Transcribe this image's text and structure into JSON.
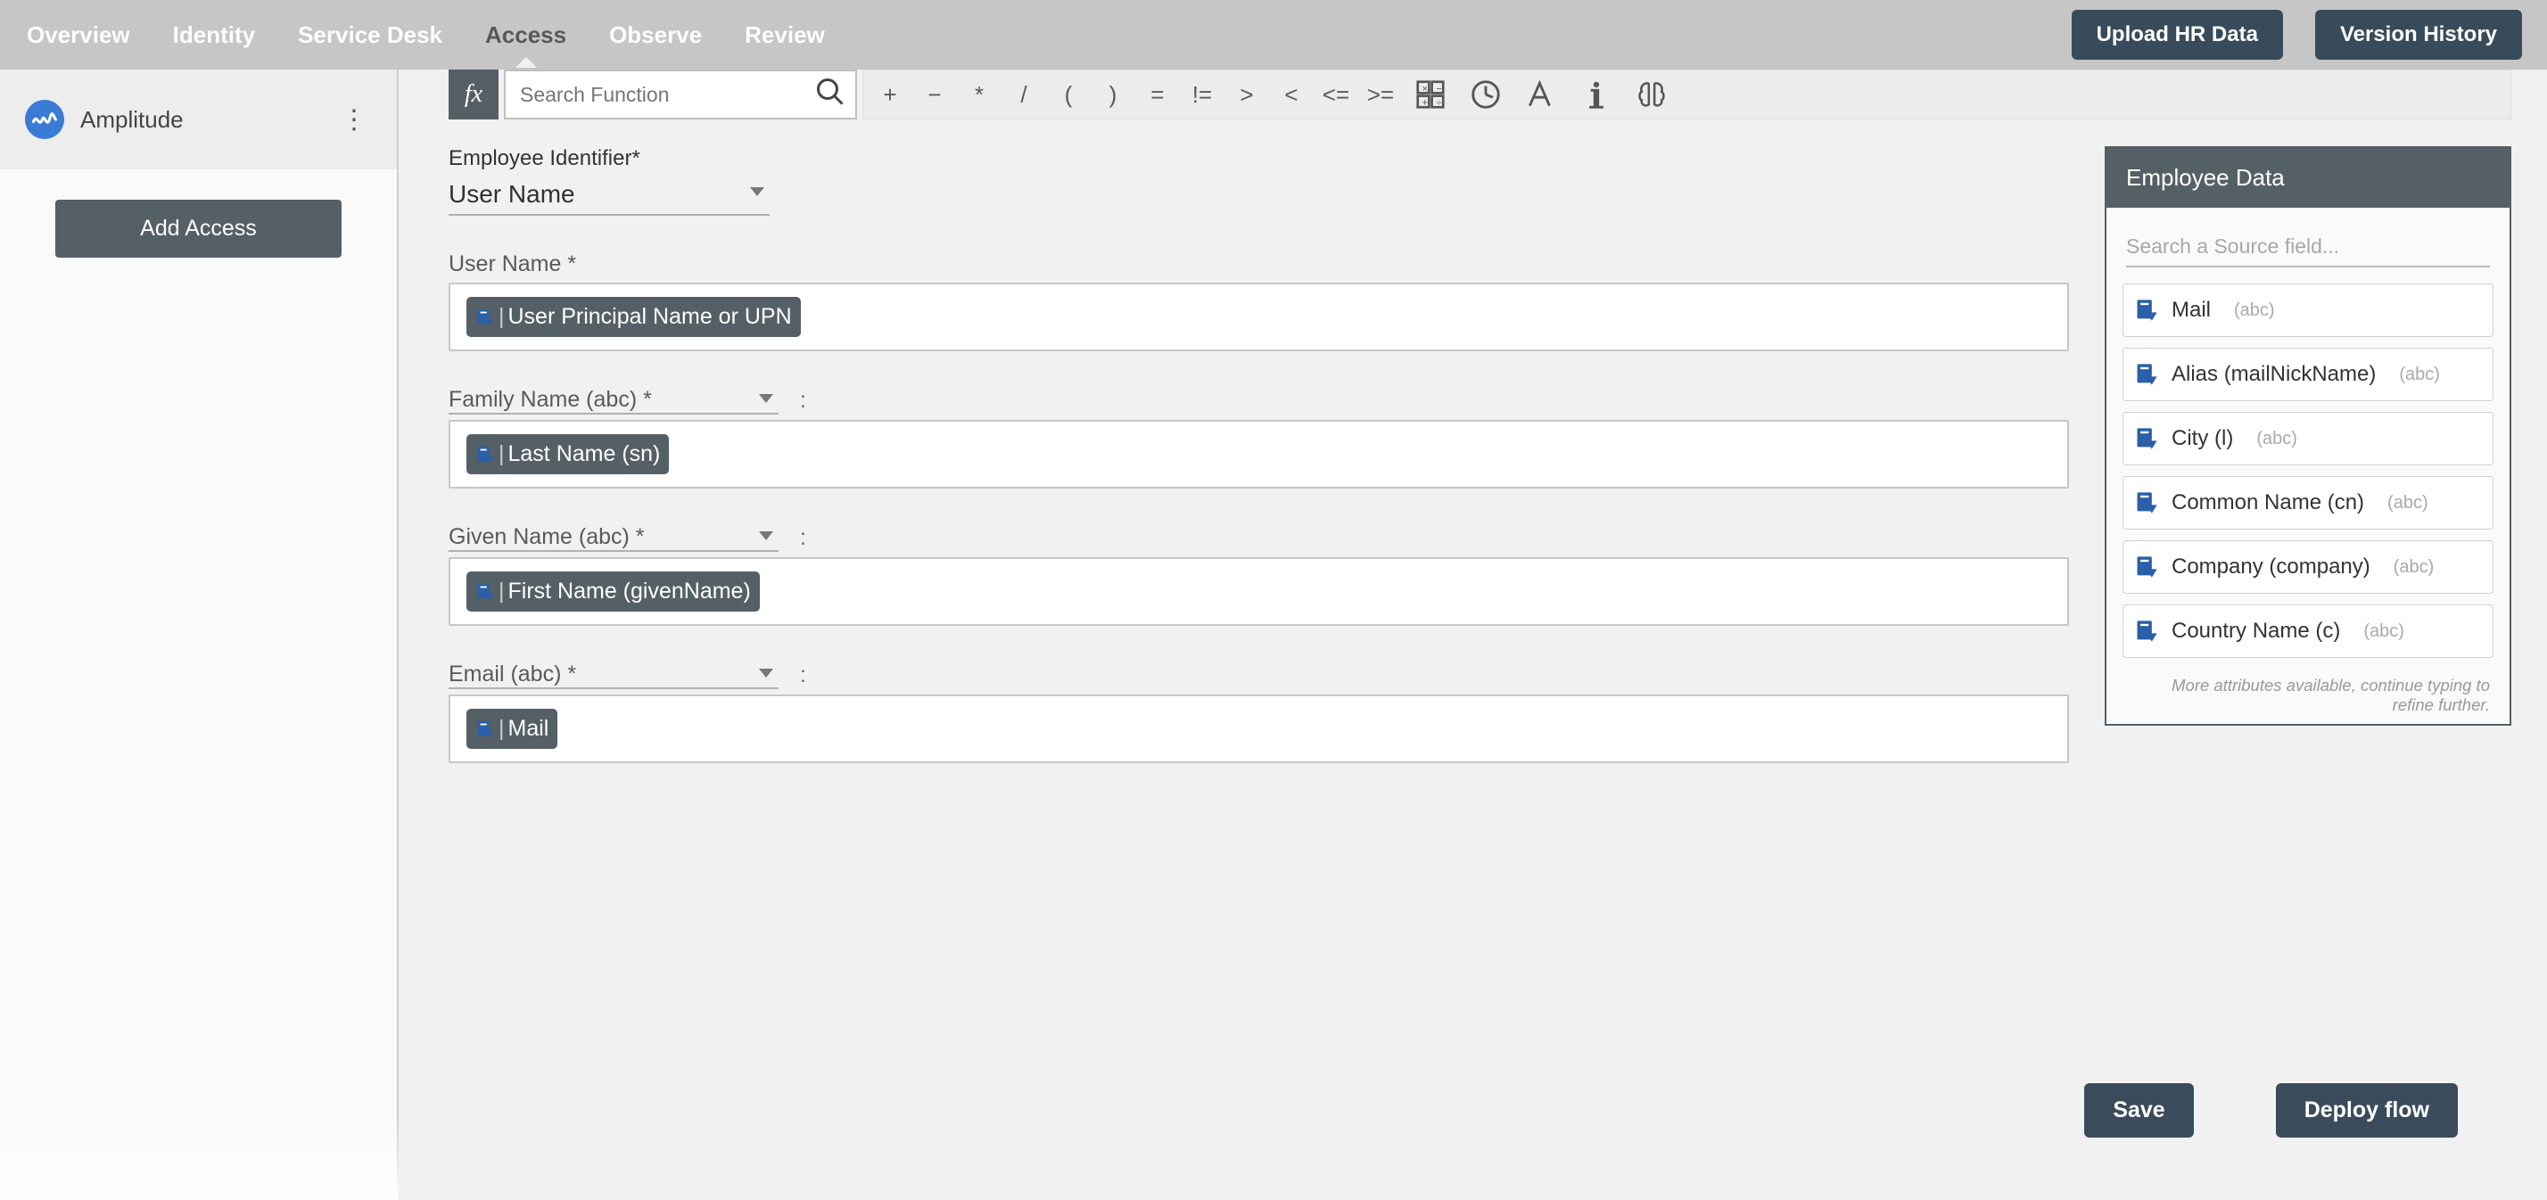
{
  "nav": {
    "tabs": [
      "Overview",
      "Identity",
      "Service Desk",
      "Access",
      "Observe",
      "Review"
    ],
    "active_index": 3,
    "upload_btn": "Upload HR Data",
    "history_btn": "Version History"
  },
  "sidebar": {
    "app_name": "Amplitude",
    "add_access": "Add Access"
  },
  "toolbar": {
    "fx": "fx",
    "search_placeholder": "Search Function",
    "ops": [
      "+",
      "−",
      "*",
      "/",
      "(",
      ")",
      "=",
      "!=",
      ">",
      "<",
      "<=",
      ">="
    ]
  },
  "form": {
    "emp_id_label": "Employee Identifier*",
    "emp_id_value": "User Name",
    "fields": [
      {
        "label": "User Name *",
        "chip": "User Principal Name or UPN",
        "has_colon": false,
        "select_style": false
      },
      {
        "label": "Family Name (abc) *",
        "chip": "Last Name (sn)",
        "has_colon": true,
        "select_style": true
      },
      {
        "label": "Given Name (abc) *",
        "chip": "First Name (givenName)",
        "has_colon": true,
        "select_style": true
      },
      {
        "label": "Email (abc) *",
        "chip": "Mail",
        "has_colon": true,
        "select_style": true
      }
    ]
  },
  "right": {
    "title": "Employee Data",
    "search_placeholder": "Search a Source field...",
    "items": [
      {
        "name": "Mail",
        "type": "(abc)"
      },
      {
        "name": "Alias (mailNickName)",
        "type": "(abc)"
      },
      {
        "name": "City (l)",
        "type": "(abc)"
      },
      {
        "name": "Common Name (cn)",
        "type": "(abc)"
      },
      {
        "name": "Company (company)",
        "type": "(abc)"
      },
      {
        "name": "Country Name (c)",
        "type": "(abc)"
      }
    ],
    "more": "More attributes available, continue typing to refine further."
  },
  "actions": {
    "save": "Save",
    "deploy": "Deploy flow"
  }
}
